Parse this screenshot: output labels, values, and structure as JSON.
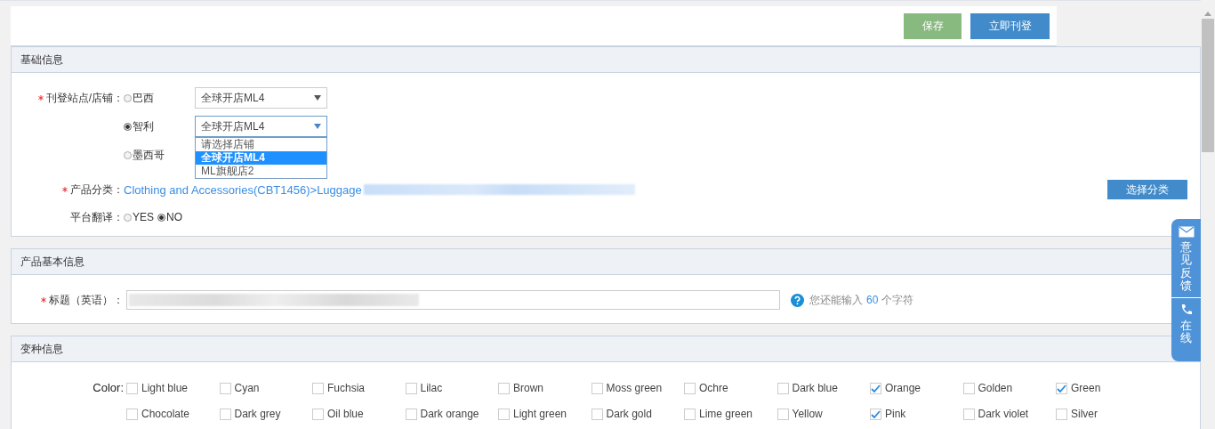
{
  "header_buttons": [
    {
      "label": "保存",
      "kind": "save"
    },
    {
      "label": "立即刊登",
      "kind": "publish"
    }
  ],
  "basic_info": {
    "title": "基础信息",
    "site_label": {
      "text": "刊登站点/店铺：",
      "required": true
    },
    "sites": [
      {
        "name": "巴西",
        "selected": false,
        "store": "全球开店ML4",
        "open": false
      },
      {
        "name": "智利",
        "selected": true,
        "store": "全球开店ML4",
        "open": true
      },
      {
        "name": "墨西哥",
        "selected": false
      }
    ],
    "store_options": [
      {
        "label": "请选择店铺",
        "selected": false
      },
      {
        "label": "全球开店ML4",
        "selected": true
      },
      {
        "label": "ML旗舰店2",
        "selected": false
      }
    ],
    "category_label": {
      "text": "产品分类：",
      "required": true
    },
    "category_path": "Clothing and Accessories(CBT1456)>Luggage",
    "category_button": "选择分类",
    "translate_label": {
      "text": "平台翻译：",
      "required": false
    },
    "translate_options": [
      {
        "label": "YES",
        "selected": false
      },
      {
        "label": "NO",
        "selected": true
      }
    ]
  },
  "product_info": {
    "title": "产品基本信息",
    "title_label": {
      "text": "标题（英语）：",
      "required": true
    },
    "hint_prefix": "您还能输入",
    "hint_count": "60",
    "hint_suffix": "个字符"
  },
  "variants": {
    "title": "变种信息",
    "color_label": "Color:",
    "colors": [
      {
        "name": "Light blue",
        "checked": false
      },
      {
        "name": "Cyan",
        "checked": false
      },
      {
        "name": "Fuchsia",
        "checked": false
      },
      {
        "name": "Lilac",
        "checked": false
      },
      {
        "name": "Brown",
        "checked": false
      },
      {
        "name": "Moss green",
        "checked": false
      },
      {
        "name": "Ochre",
        "checked": false
      },
      {
        "name": "Dark blue",
        "checked": false
      },
      {
        "name": "Orange",
        "checked": true
      },
      {
        "name": "Golden",
        "checked": false
      },
      {
        "name": "Green",
        "checked": true
      },
      {
        "name": "Chocolate",
        "checked": false
      },
      {
        "name": "Dark grey",
        "checked": false
      },
      {
        "name": "Oil blue",
        "checked": false
      },
      {
        "name": "Dark orange",
        "checked": false
      },
      {
        "name": "Light green",
        "checked": false
      },
      {
        "name": "Dark gold",
        "checked": false
      },
      {
        "name": "Lime green",
        "checked": false
      },
      {
        "name": "Yellow",
        "checked": false
      },
      {
        "name": "Pink",
        "checked": true
      },
      {
        "name": "Dark violet",
        "checked": false
      },
      {
        "name": "Silver",
        "checked": false
      }
    ]
  },
  "feedback_widget": {
    "feedback_label": "意见反馈",
    "online_label": "在线"
  }
}
